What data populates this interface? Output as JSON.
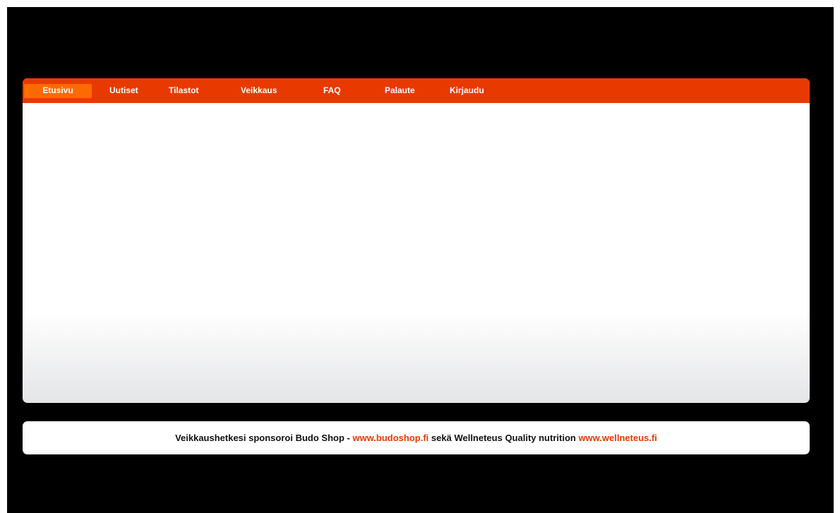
{
  "nav": {
    "items": [
      {
        "label": "Etusivu",
        "active": true
      },
      {
        "label": "Uutiset",
        "active": false
      },
      {
        "label": "Tilastot",
        "active": false
      },
      {
        "label": "Veikkaus",
        "active": false
      },
      {
        "label": "FAQ",
        "active": false
      },
      {
        "label": "Palaute",
        "active": false
      },
      {
        "label": "Kirjaudu",
        "active": false
      }
    ]
  },
  "footer": {
    "text_before": "Veikkaushetkesi sponsoroi Budo Shop - ",
    "link1": "www.budoshop.fi",
    "text_middle": " sekä Wellneteus Quality nutrition ",
    "link2": "www.wellneteus.fi"
  },
  "colors": {
    "background": "#000000",
    "nav_bar": "#e83a00",
    "nav_active": "#ff6a00",
    "link": "#e83a00"
  }
}
